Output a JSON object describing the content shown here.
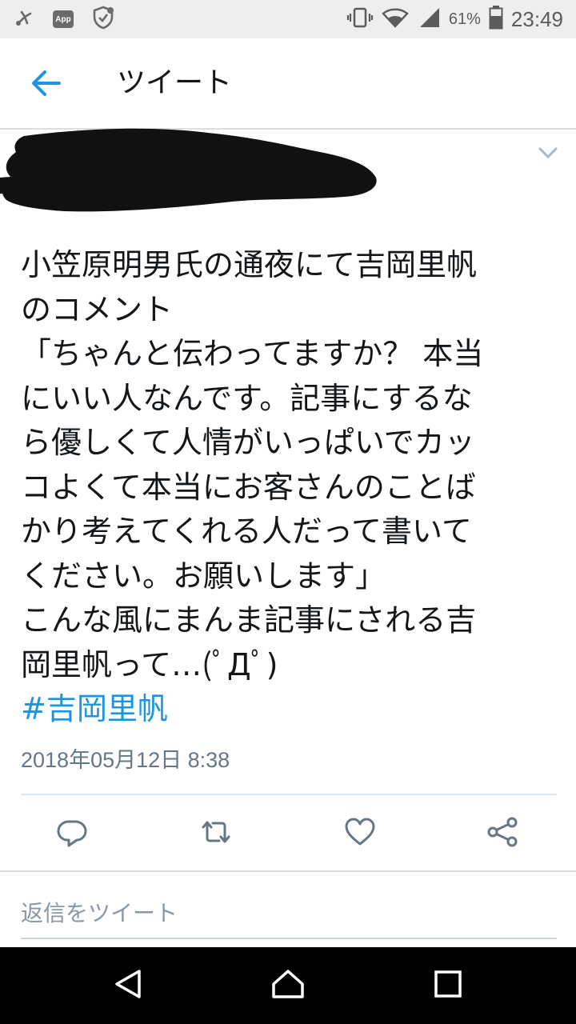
{
  "status_bar": {
    "app_badge": "App",
    "battery_percent": "61%",
    "battery_level": 0.61,
    "clock": "23:49"
  },
  "header": {
    "title": "ツイート"
  },
  "tweet": {
    "text": "小笠原明男氏の通夜にて吉岡里帆\nのコメント\n「ちゃんと伝わってますか？ 本当\nにいい人なんです。記事にするな\nら優しくて人情がいっぱいでカッ\nコよくて本当にお客さんのことば\nかり考えてくれる人だって書いて\nください。お願いします」\nこんな風にまんま記事にされる吉\n岡里帆って…(ﾟДﾟ)",
    "hashtag": "#吉岡里帆",
    "timestamp": "2018年05月12日 8:38"
  },
  "reply": {
    "placeholder": "返信をツイート"
  },
  "colors": {
    "accent": "#1b95e0",
    "icon": "#657786",
    "status_bar_bg": "#eeeeee",
    "nav_bar_bg": "#000000"
  }
}
